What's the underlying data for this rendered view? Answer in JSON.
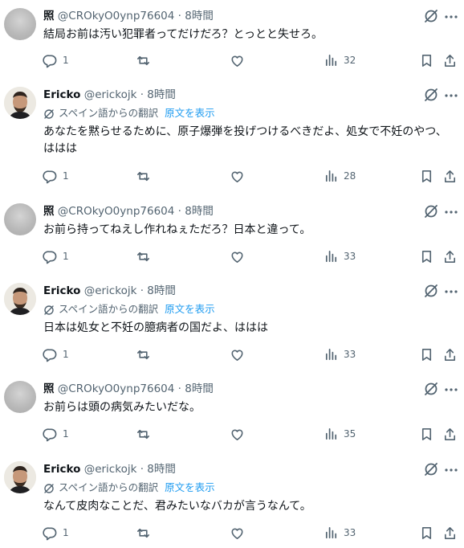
{
  "translate_label": "スペイン語からの翻訳",
  "show_original": "原文を表示",
  "tweets": [
    {
      "name": "照",
      "handle": "@CROkyO0ynp76604",
      "dot": "·",
      "time": "8時間",
      "translated": false,
      "avatar": "gray",
      "body": "結局お前は汚い犯罪者ってだけだろ？とっとと失せろ。",
      "replies": "1",
      "retweets": "",
      "likes": "",
      "views": "32"
    },
    {
      "name": "Ericko",
      "handle": "@erickojk",
      "dot": "·",
      "time": "8時間",
      "translated": true,
      "avatar": "face",
      "body": "あなたを黙らせるために、原子爆弾を投げつけるべきだよ、処女で不妊のやつ、ははは",
      "replies": "1",
      "retweets": "",
      "likes": "",
      "views": "28"
    },
    {
      "name": "照",
      "handle": "@CROkyO0ynp76604",
      "dot": "·",
      "time": "8時間",
      "translated": false,
      "avatar": "gray",
      "body": "お前ら持ってねえし作れねぇただろ？日本と違って。",
      "replies": "1",
      "retweets": "",
      "likes": "",
      "views": "33"
    },
    {
      "name": "Ericko",
      "handle": "@erickojk",
      "dot": "·",
      "time": "8時間",
      "translated": true,
      "avatar": "face",
      "body": "日本は処女と不妊の臆病者の国だよ、ははは",
      "replies": "1",
      "retweets": "",
      "likes": "",
      "views": "33"
    },
    {
      "name": "照",
      "handle": "@CROkyO0ynp76604",
      "dot": "·",
      "time": "8時間",
      "translated": false,
      "avatar": "gray",
      "body": "お前らは頭の病気みたいだな。",
      "replies": "1",
      "retweets": "",
      "likes": "",
      "views": "35"
    },
    {
      "name": "Ericko",
      "handle": "@erickojk",
      "dot": "·",
      "time": "8時間",
      "translated": true,
      "avatar": "face",
      "body": "なんて皮肉なことだ、君みたいなバカが言うなんて。",
      "replies": "1",
      "retweets": "",
      "likes": "",
      "views": "33"
    }
  ]
}
